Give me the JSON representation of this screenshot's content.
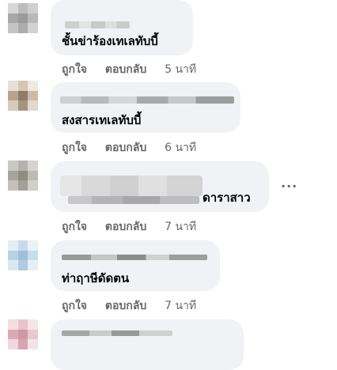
{
  "comments": [
    {
      "text": "ชั้นข่าร้องเทเลทับบี้",
      "like": "ถูกใจ",
      "reply": "ตอบกลับ",
      "time": "5 นาที"
    },
    {
      "text": "สงสารเทเลทับบี้",
      "like": "ถูกใจ",
      "reply": "ตอบกลับ",
      "time": "6 นาที"
    },
    {
      "text": "ดาราสาว",
      "like": "ถูกใจ",
      "reply": "ตอบกลับ",
      "time": "7 นาที",
      "more": "···"
    },
    {
      "text": "ท่าฤาษีดัดตน",
      "like": "ถูกใจ",
      "reply": "ตอบกลับ",
      "time": "7 นาที"
    },
    {
      "text": ""
    }
  ],
  "colors": {
    "bubble": "#f0f2f5",
    "secondary_text": "#65676b",
    "primary_text": "#050505"
  }
}
